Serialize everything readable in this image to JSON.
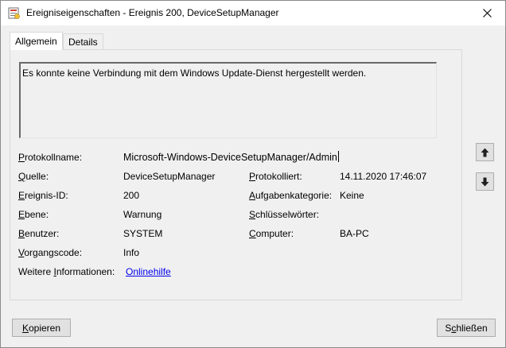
{
  "window": {
    "title": "Ereigniseigenschaften - Ereignis 200, DeviceSetupManager",
    "icon": "event-viewer-icon",
    "close_icon": "close-icon"
  },
  "tabs": [
    {
      "label": "Allgemein",
      "active": true
    },
    {
      "label": "Details",
      "active": false
    }
  ],
  "description": "Es konnte keine Verbindung mit dem Windows Update-Dienst hergestellt werden.",
  "fields": {
    "protokollname": {
      "label_key": "P",
      "label_rest": "rotokollname:",
      "value": "Microsoft-Windows-DeviceSetupManager/Admin"
    },
    "quelle": {
      "label_key": "Q",
      "label_rest": "uelle:",
      "value": "DeviceSetupManager"
    },
    "protokolliert": {
      "label_key": "P",
      "label_rest": "rotokolliert:",
      "value": "14.11.2020 17:46:07"
    },
    "ereignis_id": {
      "label_key": "E",
      "label_rest": "reignis-ID:",
      "value": "200"
    },
    "aufgabenkategorie": {
      "label_key": "A",
      "label_rest": "ufgabenkategorie:",
      "value": "Keine"
    },
    "ebene": {
      "label_key": "E",
      "label_rest": "bene:",
      "value": "Warnung"
    },
    "schluesselwoerter": {
      "label_key": "S",
      "label_rest": "chlüsselwörter:",
      "value": ""
    },
    "benutzer": {
      "label_key": "B",
      "label_rest": "enutzer:",
      "value": "SYSTEM"
    },
    "computer": {
      "label_key": "C",
      "label_rest": "omputer:",
      "value": "BA-PC"
    },
    "vorgangscode": {
      "label_key": "V",
      "label_rest": "organgscode:",
      "value": "Info"
    },
    "weitere": {
      "label_pre": "Weitere ",
      "label_key": "I",
      "label_rest": "nformationen:",
      "link": "Onlinehilfe"
    }
  },
  "nav": {
    "up_icon": "arrow-up-icon",
    "down_icon": "arrow-down-icon"
  },
  "buttons": {
    "copy_key": "K",
    "copy_rest": "opieren",
    "close_pre": "S",
    "close_key": "c",
    "close_rest": "hließen"
  }
}
